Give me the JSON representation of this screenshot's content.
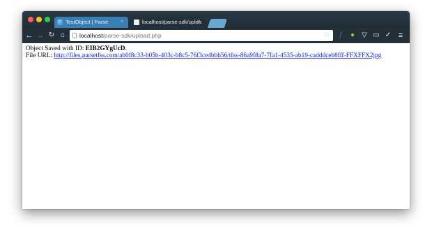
{
  "browser": {
    "tabs": [
      {
        "label": "TestObject | Parse",
        "icon": "P",
        "active": false
      },
      {
        "label": "localhost/parse-sdk/uploa",
        "active": true
      }
    ],
    "url": {
      "host": "localhost",
      "path": "/parse-sdk/upload.php"
    },
    "extensions": [
      "fx-icon",
      "android-icon",
      "shield-icon",
      "cast-icon",
      "checkmark-icon",
      "menu-icon"
    ]
  },
  "page": {
    "line1_prefix": "Object Saved with ID: ",
    "object_id": "EIB2GYgUcD",
    "line1_suffix": ".",
    "line2_prefix": "File URL: ",
    "file_url": "http://files.parsetfss.com/ab0f8c33-b05b-403c-b8c5-76f3ce4bbb56/tfss-86a9f8a7-7fa1-4535-ab19-cadddceb8fff-FFXFFX2jpg"
  }
}
